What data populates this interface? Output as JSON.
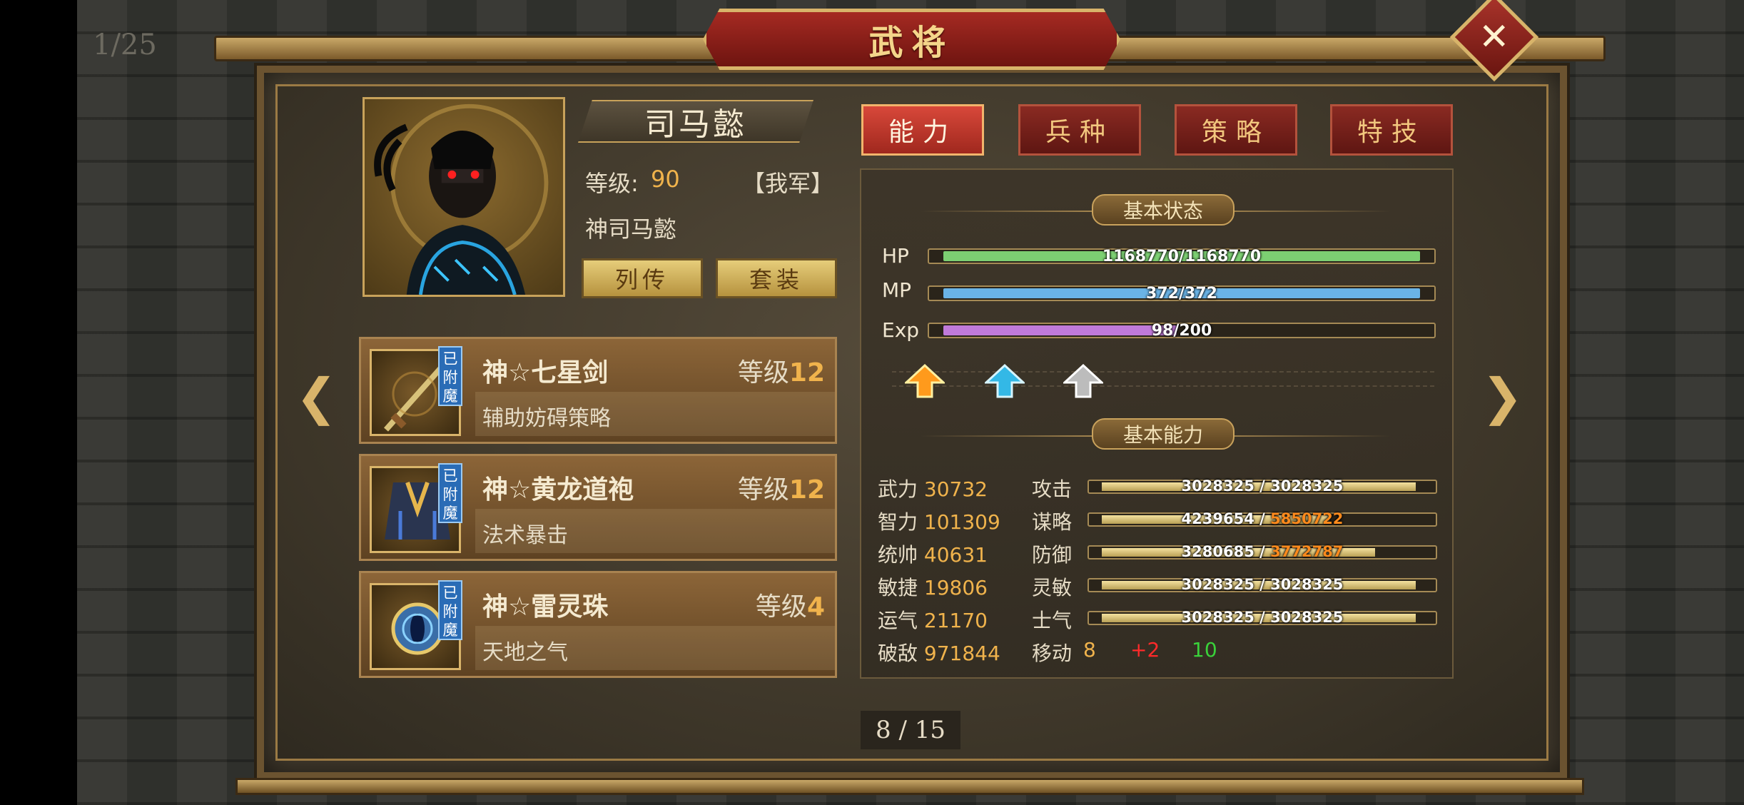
{
  "background": {
    "page_count": "1/25"
  },
  "title": "武将",
  "hero": {
    "name": "司马懿",
    "level_label": "等级:",
    "level_value": "90",
    "faction": "【我军】",
    "title": "神司马懿",
    "bio_button": "列传",
    "set_button": "套装"
  },
  "tabs": [
    {
      "label": "能力",
      "active": true
    },
    {
      "label": "兵种",
      "active": false
    },
    {
      "label": "策略",
      "active": false
    },
    {
      "label": "特技",
      "active": false
    }
  ],
  "equipment": [
    {
      "name": "神☆七星剑",
      "level_label": "等级",
      "level": "12",
      "desc": "辅助妨碍策略",
      "badge": "已附魔",
      "icon": "sword-icon"
    },
    {
      "name": "神☆黄龙道袍",
      "level_label": "等级",
      "level": "12",
      "desc": "法术暴击",
      "badge": "已附魔",
      "icon": "robe-icon"
    },
    {
      "name": "神☆雷灵珠",
      "level_label": "等级",
      "level": "4",
      "desc": "天地之气",
      "badge": "已附魔",
      "icon": "orb-icon"
    }
  ],
  "basic_status": {
    "header": "基本状态",
    "bars": [
      {
        "label": "HP",
        "text": "1168770/1168770",
        "fill": 1.0,
        "color": "#7ccf72"
      },
      {
        "label": "MP",
        "text": "372/372",
        "fill": 1.0,
        "color": "#6ab3e6"
      },
      {
        "label": "Exp",
        "text": "98/200",
        "fill": 0.49,
        "color": "#c07ad9"
      }
    ]
  },
  "basic_ability": {
    "header": "基本能力",
    "rows": [
      {
        "label": "武力",
        "value": "30732",
        "label2": "攻击",
        "cur": "3028325",
        "max": "3028325",
        "max_orange": false
      },
      {
        "label": "智力",
        "value": "101309",
        "label2": "谋略",
        "cur": "4239654",
        "max": "5850722",
        "max_orange": true
      },
      {
        "label": "统帅",
        "value": "40631",
        "label2": "防御",
        "cur": "3280685",
        "max": "3772787",
        "max_orange": true
      },
      {
        "label": "敏捷",
        "value": "19806",
        "label2": "灵敏",
        "cur": "3028325",
        "max": "3028325",
        "max_orange": false
      },
      {
        "label": "运气",
        "value": "21170",
        "label2": "士气",
        "cur": "3028325",
        "max": "3028325",
        "max_orange": false
      }
    ],
    "last_row": {
      "label": "破敌",
      "value": "971844",
      "label2": "移动",
      "move": "8",
      "bonus": "+2",
      "total": "10"
    }
  },
  "page_indicator": "8 / 15",
  "colors": {
    "accent_red": "#a52a22",
    "gold": "#f0b34c",
    "bonus_red": "#ff2a2a",
    "total_green": "#3ad13a"
  }
}
